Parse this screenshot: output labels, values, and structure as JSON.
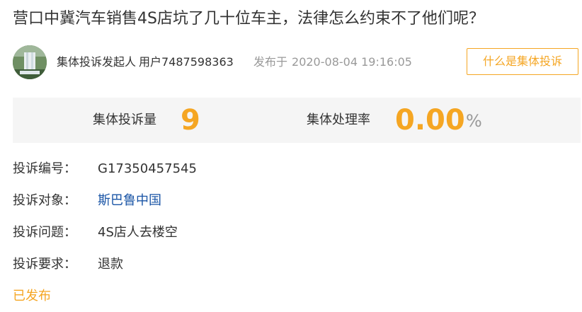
{
  "title": "营口中冀汽车销售4S店坑了几十位车主，法律怎么约束不了他们呢？",
  "author": {
    "avatar_icon": "waterfall-avatar",
    "role": "集体投诉发起人",
    "user": "用户7487598363",
    "published_prefix": "发布于",
    "published_at": "2020-08-04 19:16:05"
  },
  "what_button_label": "什么是集体投诉",
  "stats": {
    "count_label": "集体投诉量",
    "count_value": "9",
    "rate_label": "集体处理率",
    "rate_value": "0.00",
    "rate_unit": "%"
  },
  "details": [
    {
      "label": "投诉编号：",
      "value": "G17350457545"
    },
    {
      "label": "投诉对象：",
      "value": "斯巴鲁中国"
    },
    {
      "label": "投诉问题：",
      "value": "4S店人去楼空"
    },
    {
      "label": "投诉要求：",
      "value": "退款"
    }
  ],
  "status": "已发布",
  "colors": {
    "accent": "#f5a623",
    "link": "#1a55a6",
    "muted": "#999999",
    "stats_bg": "#f5f5f5"
  }
}
